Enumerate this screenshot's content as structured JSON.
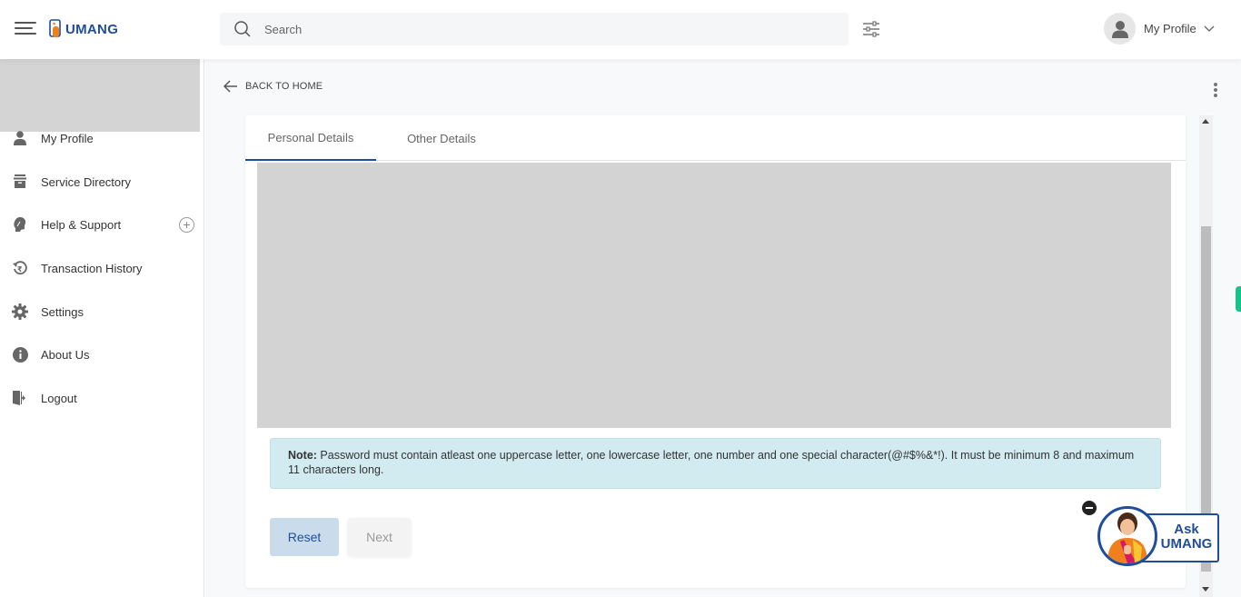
{
  "header": {
    "logo_text": "UMANG",
    "search_placeholder": "Search",
    "profile_label": "My Profile"
  },
  "sidebar": {
    "items": [
      {
        "label": "My Profile",
        "icon": "user-icon"
      },
      {
        "label": "Service Directory",
        "icon": "archive-icon"
      },
      {
        "label": "Help & Support",
        "icon": "support-icon",
        "expandable": true
      },
      {
        "label": "Transaction History",
        "icon": "rupee-history-icon"
      },
      {
        "label": "Settings",
        "icon": "gear-icon"
      },
      {
        "label": "About Us",
        "icon": "info-icon"
      },
      {
        "label": "Logout",
        "icon": "logout-icon"
      }
    ]
  },
  "main": {
    "back_label": "BACK TO HOME",
    "tabs": [
      {
        "label": "Personal Details",
        "active": true
      },
      {
        "label": "Other Details",
        "active": false
      }
    ],
    "note_label": "Note:",
    "note_text": " Password must contain atleast one uppercase letter, one lowercase letter, one number and one special character(@#$%&*!). It must be minimum 8 and maximum 11 characters long.",
    "buttons": {
      "reset": "Reset",
      "next": "Next"
    }
  },
  "chatbot": {
    "line1": "Ask",
    "line2": "UMANG"
  },
  "colors": {
    "brand": "#1f4d9b",
    "accent_orange": "#f07f1e",
    "note_bg": "#d1ebf0",
    "green_tab": "#18c38b"
  }
}
